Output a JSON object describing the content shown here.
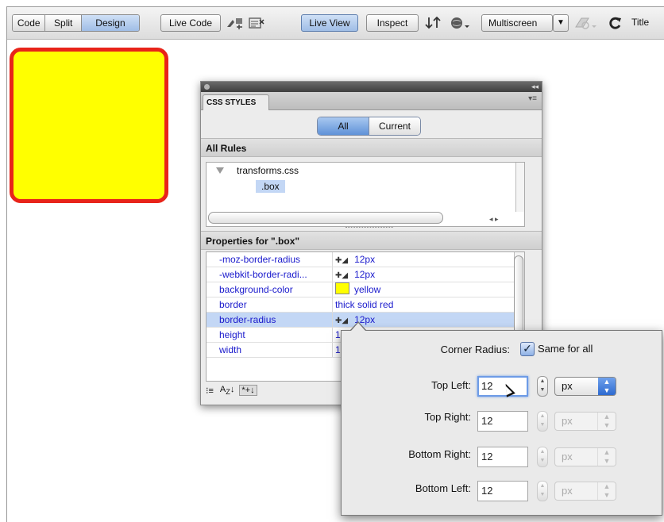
{
  "toolbar": {
    "view_modes": [
      "Code",
      "Split",
      "Design"
    ],
    "active_view_mode": "Design",
    "live_code_label": "Live Code",
    "live_view_label": "Live View",
    "inspect_label": "Inspect",
    "multiscreen_label": "Multiscreen",
    "title_label": "Title"
  },
  "css_panel": {
    "tab_label": "CSS STYLES",
    "mode_buttons": [
      "All",
      "Current"
    ],
    "active_mode": "All",
    "all_rules_header": "All Rules",
    "stylesheet": "transforms.css",
    "selected_rule": ".box",
    "properties_header": "Properties for \".box\"",
    "properties": [
      {
        "name": "-moz-border-radius",
        "value": "12px"
      },
      {
        "name": "-webkit-border-radi...",
        "value": "12px"
      },
      {
        "name": "background-color",
        "value": "yellow"
      },
      {
        "name": "border",
        "value": "thick solid red"
      },
      {
        "name": "border-radius",
        "value": "12px"
      },
      {
        "name": "height",
        "value": "1"
      },
      {
        "name": "width",
        "value": "1"
      }
    ],
    "selected_property": "border-radius"
  },
  "radius_popup": {
    "corner_radius_label": "Corner Radius:",
    "same_for_all_label": "Same for all",
    "same_for_all_checked": true,
    "rows": [
      {
        "label": "Top Left:",
        "value": "12",
        "unit": "px",
        "enabled": true
      },
      {
        "label": "Top Right:",
        "value": "12",
        "unit": "px",
        "enabled": false
      },
      {
        "label": "Bottom Right:",
        "value": "12",
        "unit": "px",
        "enabled": false
      },
      {
        "label": "Bottom Left:",
        "value": "12",
        "unit": "px",
        "enabled": false
      }
    ]
  },
  "colors": {
    "preview_box_fill": "#ffff00",
    "preview_box_border": "#e8241a",
    "property_text": "#1a1acc",
    "selection": "#c3d7f5"
  }
}
